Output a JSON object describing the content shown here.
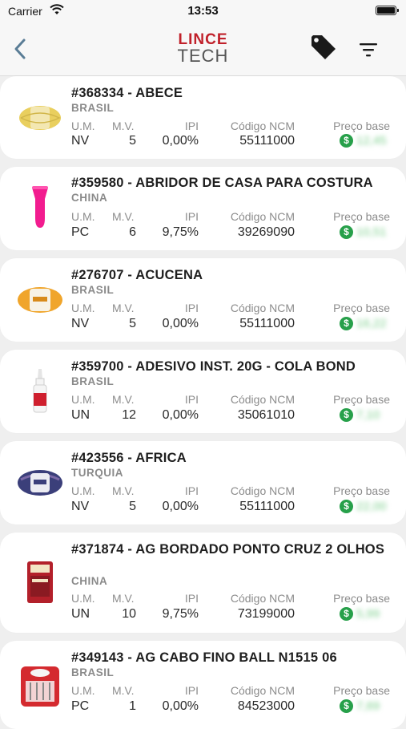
{
  "status_bar": {
    "carrier": "Carrier",
    "time": "13:53"
  },
  "header": {
    "logo_top": "LINCE",
    "logo_bottom": "TECH"
  },
  "columns": {
    "um": "U.M.",
    "mv": "M.V.",
    "ipi": "IPI",
    "ncm": "Código NCM",
    "price": "Preço base"
  },
  "products": [
    {
      "title": "#368334 - ABECE",
      "origin": "BRASIL",
      "um": "NV",
      "mv": "5",
      "ipi": "0,00%",
      "ncm": "55111000",
      "price": "12,45"
    },
    {
      "title": "#359580 - ABRIDOR DE CASA PARA COSTURA",
      "origin": "CHINA",
      "um": "PC",
      "mv": "6",
      "ipi": "9,75%",
      "ncm": "39269090",
      "price": "10,51"
    },
    {
      "title": "#276707 - ACUCENA",
      "origin": "BRASIL",
      "um": "NV",
      "mv": "5",
      "ipi": "0,00%",
      "ncm": "55111000",
      "price": "16,22"
    },
    {
      "title": "#359700 - ADESIVO INST. 20G - COLA BOND",
      "origin": "BRASIL",
      "um": "UN",
      "mv": "12",
      "ipi": "0,00%",
      "ncm": "35061010",
      "price": "7,10"
    },
    {
      "title": "#423556 - AFRICA",
      "origin": "TURQUIA",
      "um": "NV",
      "mv": "5",
      "ipi": "0,00%",
      "ncm": "55111000",
      "price": "22,00"
    },
    {
      "title": "#371874 - AG BORDADO PONTO CRUZ 2 OLHOS",
      "origin": "CHINA",
      "um": "UN",
      "mv": "10",
      "ipi": "9,75%",
      "ncm": "73199000",
      "price": "5,99"
    },
    {
      "title": "#349143 - AG CABO FINO BALL N1515 06",
      "origin": "BRASIL",
      "um": "PC",
      "mv": "1",
      "ipi": "0,00%",
      "ncm": "84523000",
      "price": "7,69"
    }
  ]
}
